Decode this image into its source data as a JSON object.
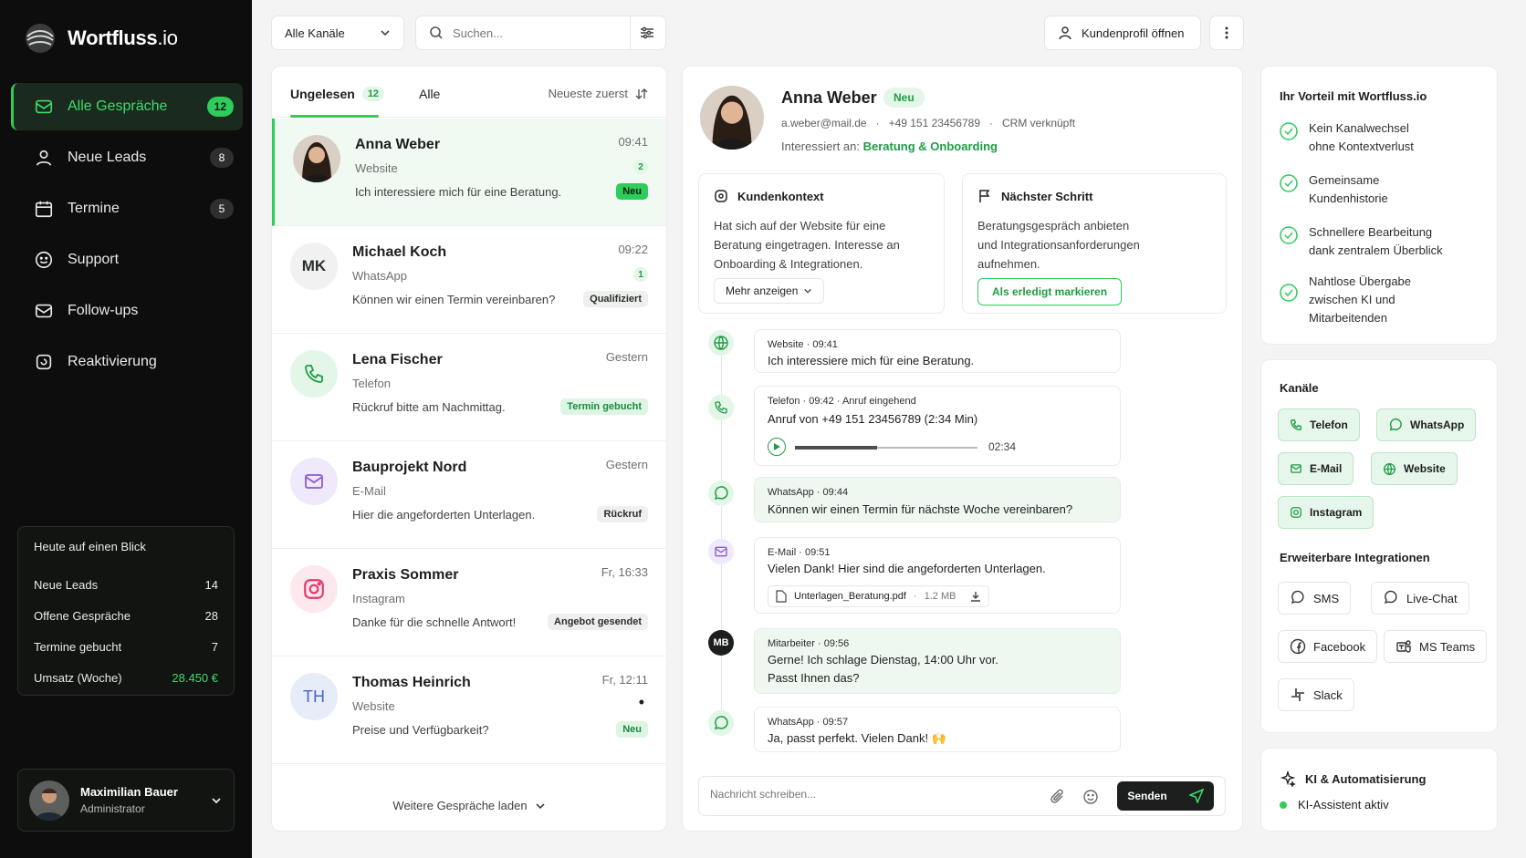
{
  "brand": {
    "name_bold": "Wortfluss",
    "name_light": ".io"
  },
  "nav": [
    {
      "label": "Alle Gespräche",
      "count": "12",
      "icon": "inbox-icon"
    },
    {
      "label": "Neue Leads",
      "count": "8",
      "icon": "person-icon"
    },
    {
      "label": "Termine",
      "count": "5",
      "icon": "calendar-icon"
    },
    {
      "label": "Support",
      "count": "",
      "icon": "support-icon"
    },
    {
      "label": "Follow-ups",
      "count": "",
      "icon": "mail-icon"
    },
    {
      "label": "Reaktivierung",
      "count": "",
      "icon": "refresh-icon"
    }
  ],
  "summary": {
    "title": "Heute auf einen Blick",
    "rows": [
      {
        "label": "Neue Leads",
        "value": "14"
      },
      {
        "label": "Offene Gespräche",
        "value": "28"
      },
      {
        "label": "Termine gebucht",
        "value": "7"
      },
      {
        "label": "Umsatz (Woche)",
        "value": "28.450 €"
      }
    ]
  },
  "user": {
    "name": "Maximilian Bauer",
    "role": "Administrator"
  },
  "topbar": {
    "channel_select": "Alle Kanäle",
    "search_placeholder": "Suchen...",
    "profile_button": "Kundenprofil öffnen"
  },
  "list": {
    "tab_unread": "Ungelesen",
    "tab_unread_count": "12",
    "tab_all": "Alle",
    "sort": "Neueste zuerst",
    "load_more": "Weitere Gespräche laden",
    "items": [
      {
        "name": "Anna Weber",
        "channel": "Website",
        "message": "Ich interessiere mich für eine Beratung.",
        "time": "09:41",
        "badge": "2",
        "tag": "Neu"
      },
      {
        "name": "Michael Koch",
        "initials": "MK",
        "channel": "WhatsApp",
        "message": "Können wir einen Termin vereinbaren?",
        "time": "09:22",
        "badge": "1",
        "tag": "Qualifiziert"
      },
      {
        "name": "Lena Fischer",
        "channel": "Telefon",
        "message": "Rückruf bitte am Nachmittag.",
        "time": "Gestern",
        "badge": "",
        "tag": "Termin gebucht"
      },
      {
        "name": "Bauprojekt Nord",
        "channel": "E-Mail",
        "message": "Hier die angeforderten Unterlagen.",
        "time": "Gestern",
        "badge": "",
        "tag": "Rückruf"
      },
      {
        "name": "Praxis Sommer",
        "channel": "Instagram",
        "message": "Danke für die schnelle Antwort!",
        "time": "Fr, 16:33",
        "badge": "",
        "tag": "Angebot gesendet"
      },
      {
        "name": "Thomas Heinrich",
        "initials": "TH",
        "channel": "Website",
        "message": "Preise und Verfügbarkeit?",
        "time": "Fr, 12:11",
        "badge": "•",
        "tag": "Neu"
      }
    ]
  },
  "contact": {
    "name": "Anna Weber",
    "status": "Neu",
    "email": "a.weber@mail.de",
    "phone": "+49 151 23456789",
    "crm": "CRM verknüpft",
    "interest_label": "Interessiert an:",
    "interest": "Beratung & Onboarding",
    "context_title": "Kundenkontext",
    "context_text": [
      "Hat sich auf der Website für eine",
      "Beratung eingetragen. Interesse an",
      "Onboarding & Integrationen."
    ],
    "context_more": "Mehr anzeigen",
    "next_title": "Nächster Schritt",
    "next_text": [
      "Beratungsgespräch anbieten",
      "und Integrationsanforderungen",
      "aufnehmen."
    ],
    "next_button": "Als erledigt markieren"
  },
  "timeline": [
    {
      "channel": "Website",
      "time": "09:41",
      "extra": "",
      "text": "Ich interessiere mich für eine Beratung."
    },
    {
      "channel": "Telefon",
      "time": "09:42",
      "extra": "Anruf eingehend",
      "text": "Anruf von +49 151 23456789 (2:34 Min)",
      "duration": "02:34",
      "audio_progress": 0.45
    },
    {
      "channel": "WhatsApp",
      "time": "09:44",
      "extra": "",
      "text": "Können wir einen Termin für nächste Woche vereinbaren?"
    },
    {
      "channel": "E-Mail",
      "time": "09:51",
      "extra": "",
      "text": "Vielen Dank! Hier sind die angeforderten Unterlagen.",
      "file": "Unterlagen_Beratung.pdf",
      "file_size": "1.2 MB"
    },
    {
      "channel": "Mitarbeiter",
      "initials": "MB",
      "time": "09:56",
      "extra": "",
      "text": "Gerne! Ich schlage Dienstag, 14:00 Uhr vor.",
      "text2": "Passt Ihnen das?"
    },
    {
      "channel": "WhatsApp",
      "time": "09:57",
      "extra": "",
      "text": "Ja, passt perfekt. Vielen Dank! 🙌"
    }
  ],
  "composer": {
    "placeholder": "Nachricht schreiben...",
    "send": "Senden"
  },
  "benefits": {
    "title": "Ihr Vorteil mit Wortfluss.io",
    "items": [
      [
        "Kein Kanalwechsel",
        "ohne Kontextverlust"
      ],
      [
        "Gemeinsame",
        "Kundenhistorie"
      ],
      [
        "Schnellere Bearbeitung",
        "dank zentralem Überblick"
      ],
      [
        "Nahtlose Übergabe",
        "zwischen KI und",
        "Mitarbeitenden"
      ]
    ]
  },
  "channels": {
    "title": "Kanäle",
    "items": [
      "Telefon",
      "WhatsApp",
      "E-Mail",
      "Website",
      "Instagram"
    ]
  },
  "integrations": {
    "title": "Erweiterbare Integrationen",
    "items": [
      "SMS",
      "Live-Chat",
      "Facebook",
      "MS Teams",
      "Slack"
    ]
  },
  "ai": {
    "title": "KI & Automatisierung",
    "status": "KI-Assistent aktiv"
  },
  "colors": {
    "accent": "#2ecc5a",
    "sidebar": "#0c0d0c"
  }
}
